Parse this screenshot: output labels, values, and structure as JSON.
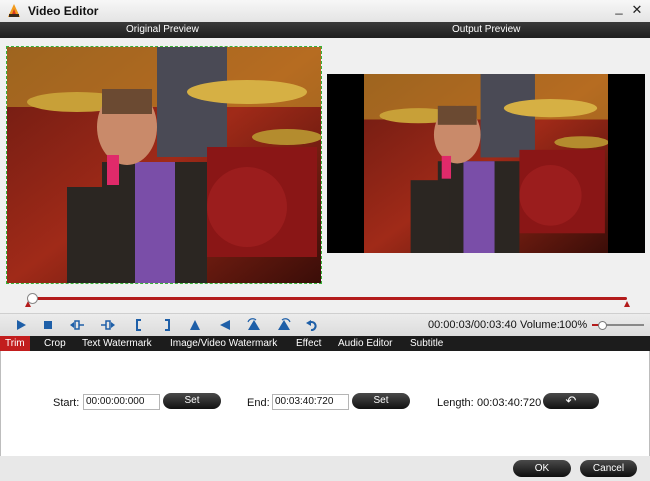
{
  "window": {
    "title": "Video Editor",
    "minimize_glyph": "_",
    "close_glyph": "✕"
  },
  "preview": {
    "original_label": "Original Preview",
    "output_label": "Output Preview"
  },
  "playback": {
    "position_fraction": 0.0,
    "time": "00:00:03/00:03:40",
    "volume_label": "Volume:",
    "volume_value": "100%",
    "volume_fraction": 0.2
  },
  "controls": [
    "play-icon",
    "stop-icon",
    "prev-frame-icon",
    "next-frame-icon",
    "mark-in-icon",
    "mark-out-icon",
    "flip-vertical-icon",
    "flip-horizontal-icon",
    "rotate-left-icon",
    "rotate-right-icon",
    "undo-icon"
  ],
  "tabs": [
    "Trim",
    "Crop",
    "Text Watermark",
    "Image/Video Watermark",
    "Effect",
    "Audio Editor",
    "Subtitle"
  ],
  "active_tab": "Trim",
  "trim": {
    "start_label": "Start:",
    "start_value": "00:00:00:000",
    "set_label": "Set",
    "end_label": "End:",
    "end_value": "00:03:40:720",
    "end_set_label": "Set",
    "length_label": "Length:",
    "length_value": "00:03:40:720",
    "reset_glyph": "↶"
  },
  "footer": {
    "ok_label": "OK",
    "cancel_label": "Cancel"
  },
  "colors": {
    "accent": "#c21d1d",
    "header": "#1c1c1c"
  }
}
